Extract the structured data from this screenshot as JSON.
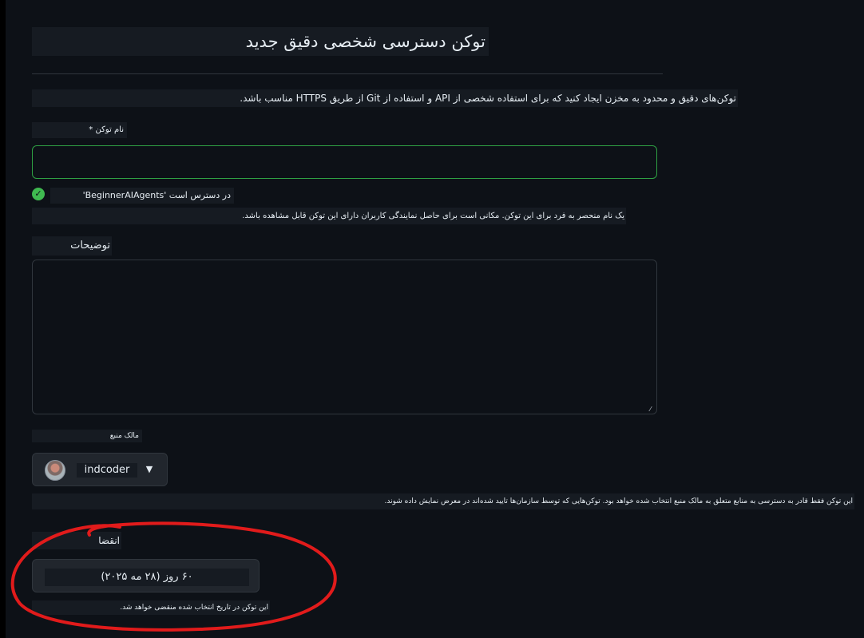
{
  "colors": {
    "background": "#0d1117",
    "field_border_valid": "#2ea043",
    "success_icon": "#3fb950",
    "annotation": "#e11b1b"
  },
  "page": {
    "title": "توکن دسترسی شخصی دقیق جدید",
    "description": "توکن‌های دقیق و محدود به مخزن ایجاد کنید که برای استفاده شخصی از API و استفاده از Git از طریق HTTPS مناسب باشد."
  },
  "token_name": {
    "label": "نام توکن *",
    "value": "",
    "availability": "در دسترس است 'BeginnerAIAgents'",
    "availability_icon": "check-circle-icon",
    "hint": "یک نام منحصر به فرد برای این توکن. مکانی است برای حاصل نمایندگی کاربران دارای این توکن قابل مشاهده باشد."
  },
  "description_field": {
    "label": "توضیحات",
    "value": ""
  },
  "owner": {
    "label": "مالک منبع",
    "selected": "indcoder",
    "hint": "این توکن فقط قادر به دسترسی به منابع متعلق به مالک منبع انتخاب شده خواهد بود. توکن‌هایی که توسط سازمان‌ها تایید شده‌اند در معرض نمایش داده شوند."
  },
  "expiration": {
    "label": "انقضا",
    "selected": "۶۰ روز (۲۸ مه ۲۰۲۵)",
    "hint": "این توکن در تاریخ انتخاب شده منقضی خواهد شد."
  }
}
